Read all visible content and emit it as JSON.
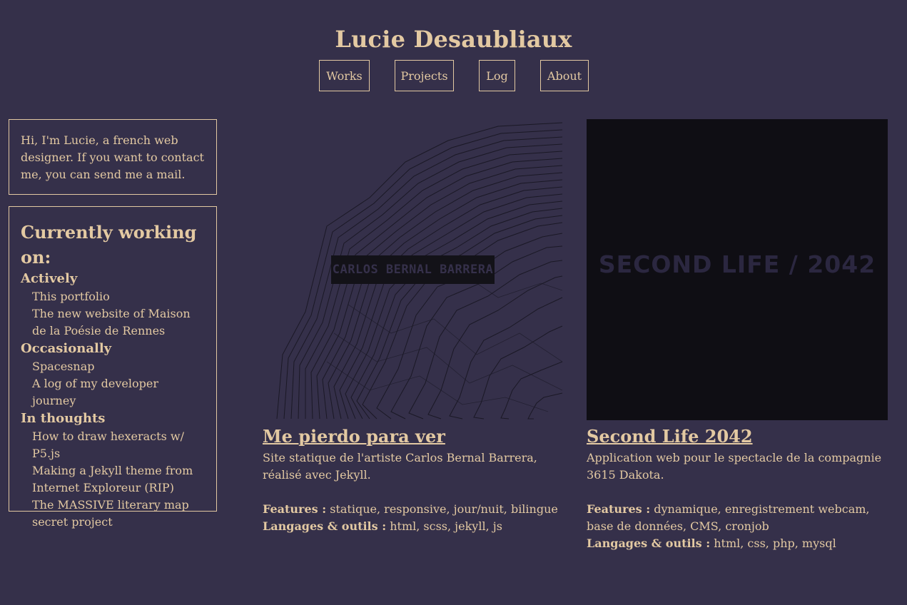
{
  "site": {
    "title": "Lucie Desaubliaux"
  },
  "nav": {
    "items": [
      "Works",
      "Projects",
      "Log",
      "About"
    ]
  },
  "intro": {
    "text": "Hi, I'm Lucie, a french web designer. If you want to contact me, you can send me a mail."
  },
  "working": {
    "heading": "Currently working on:",
    "groups": [
      {
        "title": "Actively",
        "items": [
          "This portfolio",
          "The new website of Maison de la Poésie de Rennes"
        ]
      },
      {
        "title": "Occasionally",
        "items": [
          "Spacesnap",
          "A log of my developer journey"
        ]
      },
      {
        "title": "In thoughts",
        "items": [
          "How to draw hexeracts w/ P5.js",
          "Making a Jekyll theme from Internet Exploreur (RIP)",
          "The MASSIVE literary map secret project"
        ]
      }
    ]
  },
  "projects": [
    {
      "thumb_label": "CARLOS BERNAL BARRERA",
      "title": "Me pierdo para ver",
      "description": "Site statique de l'artiste Carlos Bernal Barrera, réalisé avec Jekyll.",
      "features_label": "Features :",
      "features": "statique, responsive, jour/nuit, bilingue",
      "tools_label": "Langages & outils :",
      "tools": "html, scss, jekyll, js"
    },
    {
      "thumb_label": "SECOND LIFE / 2042",
      "title": "Second Life 2042",
      "description": "Application web pour le spectacle de la compagnie 3615 Dakota.",
      "features_label": "Features :",
      "features": "dynamique, enregistrement webcam, base de données, CMS, cronjob",
      "tools_label": "Langages & outils :",
      "tools": "html, css, php, mysql"
    }
  ],
  "colors": {
    "background": "#35304a",
    "text": "#e3c9a2",
    "dark": "#0f0e14"
  }
}
